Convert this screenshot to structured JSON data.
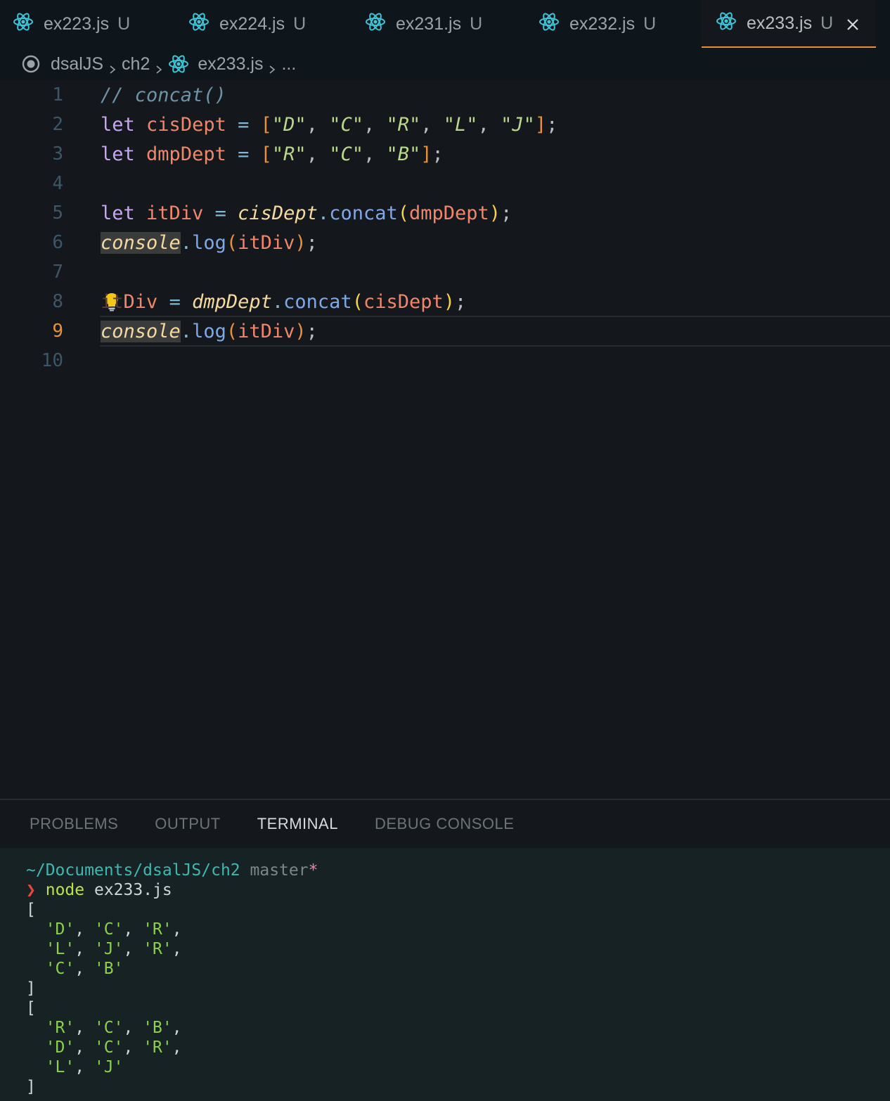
{
  "tabs": [
    {
      "name": "ex223.js",
      "status": "U",
      "active": false
    },
    {
      "name": "ex224.js",
      "status": "U",
      "active": false
    },
    {
      "name": "ex231.js",
      "status": "U",
      "active": false
    },
    {
      "name": "ex232.js",
      "status": "U",
      "active": false
    },
    {
      "name": "ex233.js",
      "status": "U",
      "active": true
    }
  ],
  "breadcrumb": {
    "root": "dsalJS",
    "folder": "ch2",
    "file": "ex233.js",
    "more": "..."
  },
  "editor": {
    "current_line": 9,
    "line_numbers": [
      "1",
      "2",
      "3",
      "4",
      "5",
      "6",
      "7",
      "8",
      "9",
      "10"
    ],
    "lines": {
      "l1_comment": "// concat()",
      "kw_let": "let",
      "cisDept": "cisDept",
      "dmpDept": "dmpDept",
      "itDiv": "itDiv",
      "l8_partial": "Div",
      "console": "console",
      "log": "log",
      "concat": "concat",
      "cis_values": [
        "\"D\"",
        "\"C\"",
        "\"R\"",
        "\"L\"",
        "\"J\""
      ],
      "dmp_values": [
        "\"R\"",
        "\"C\"",
        "\"B\""
      ]
    }
  },
  "panel": {
    "tabs": [
      "PROBLEMS",
      "OUTPUT",
      "TERMINAL",
      "DEBUG CONSOLE"
    ],
    "active_tab": "TERMINAL"
  },
  "terminal": {
    "path": "~/Documents/dsalJS/ch2",
    "branch": "master",
    "dirty": "*",
    "prompt": "❯",
    "command": "node",
    "arg": "ex233.js",
    "output1": [
      [
        "'D'",
        "'C'",
        "'R'"
      ],
      [
        "'L'",
        "'J'",
        "'R'"
      ],
      [
        "'C'",
        "'B'"
      ]
    ],
    "output2": [
      [
        "'R'",
        "'C'",
        "'B'"
      ],
      [
        "'D'",
        "'C'",
        "'R'"
      ],
      [
        "'L'",
        "'J'"
      ]
    ]
  }
}
